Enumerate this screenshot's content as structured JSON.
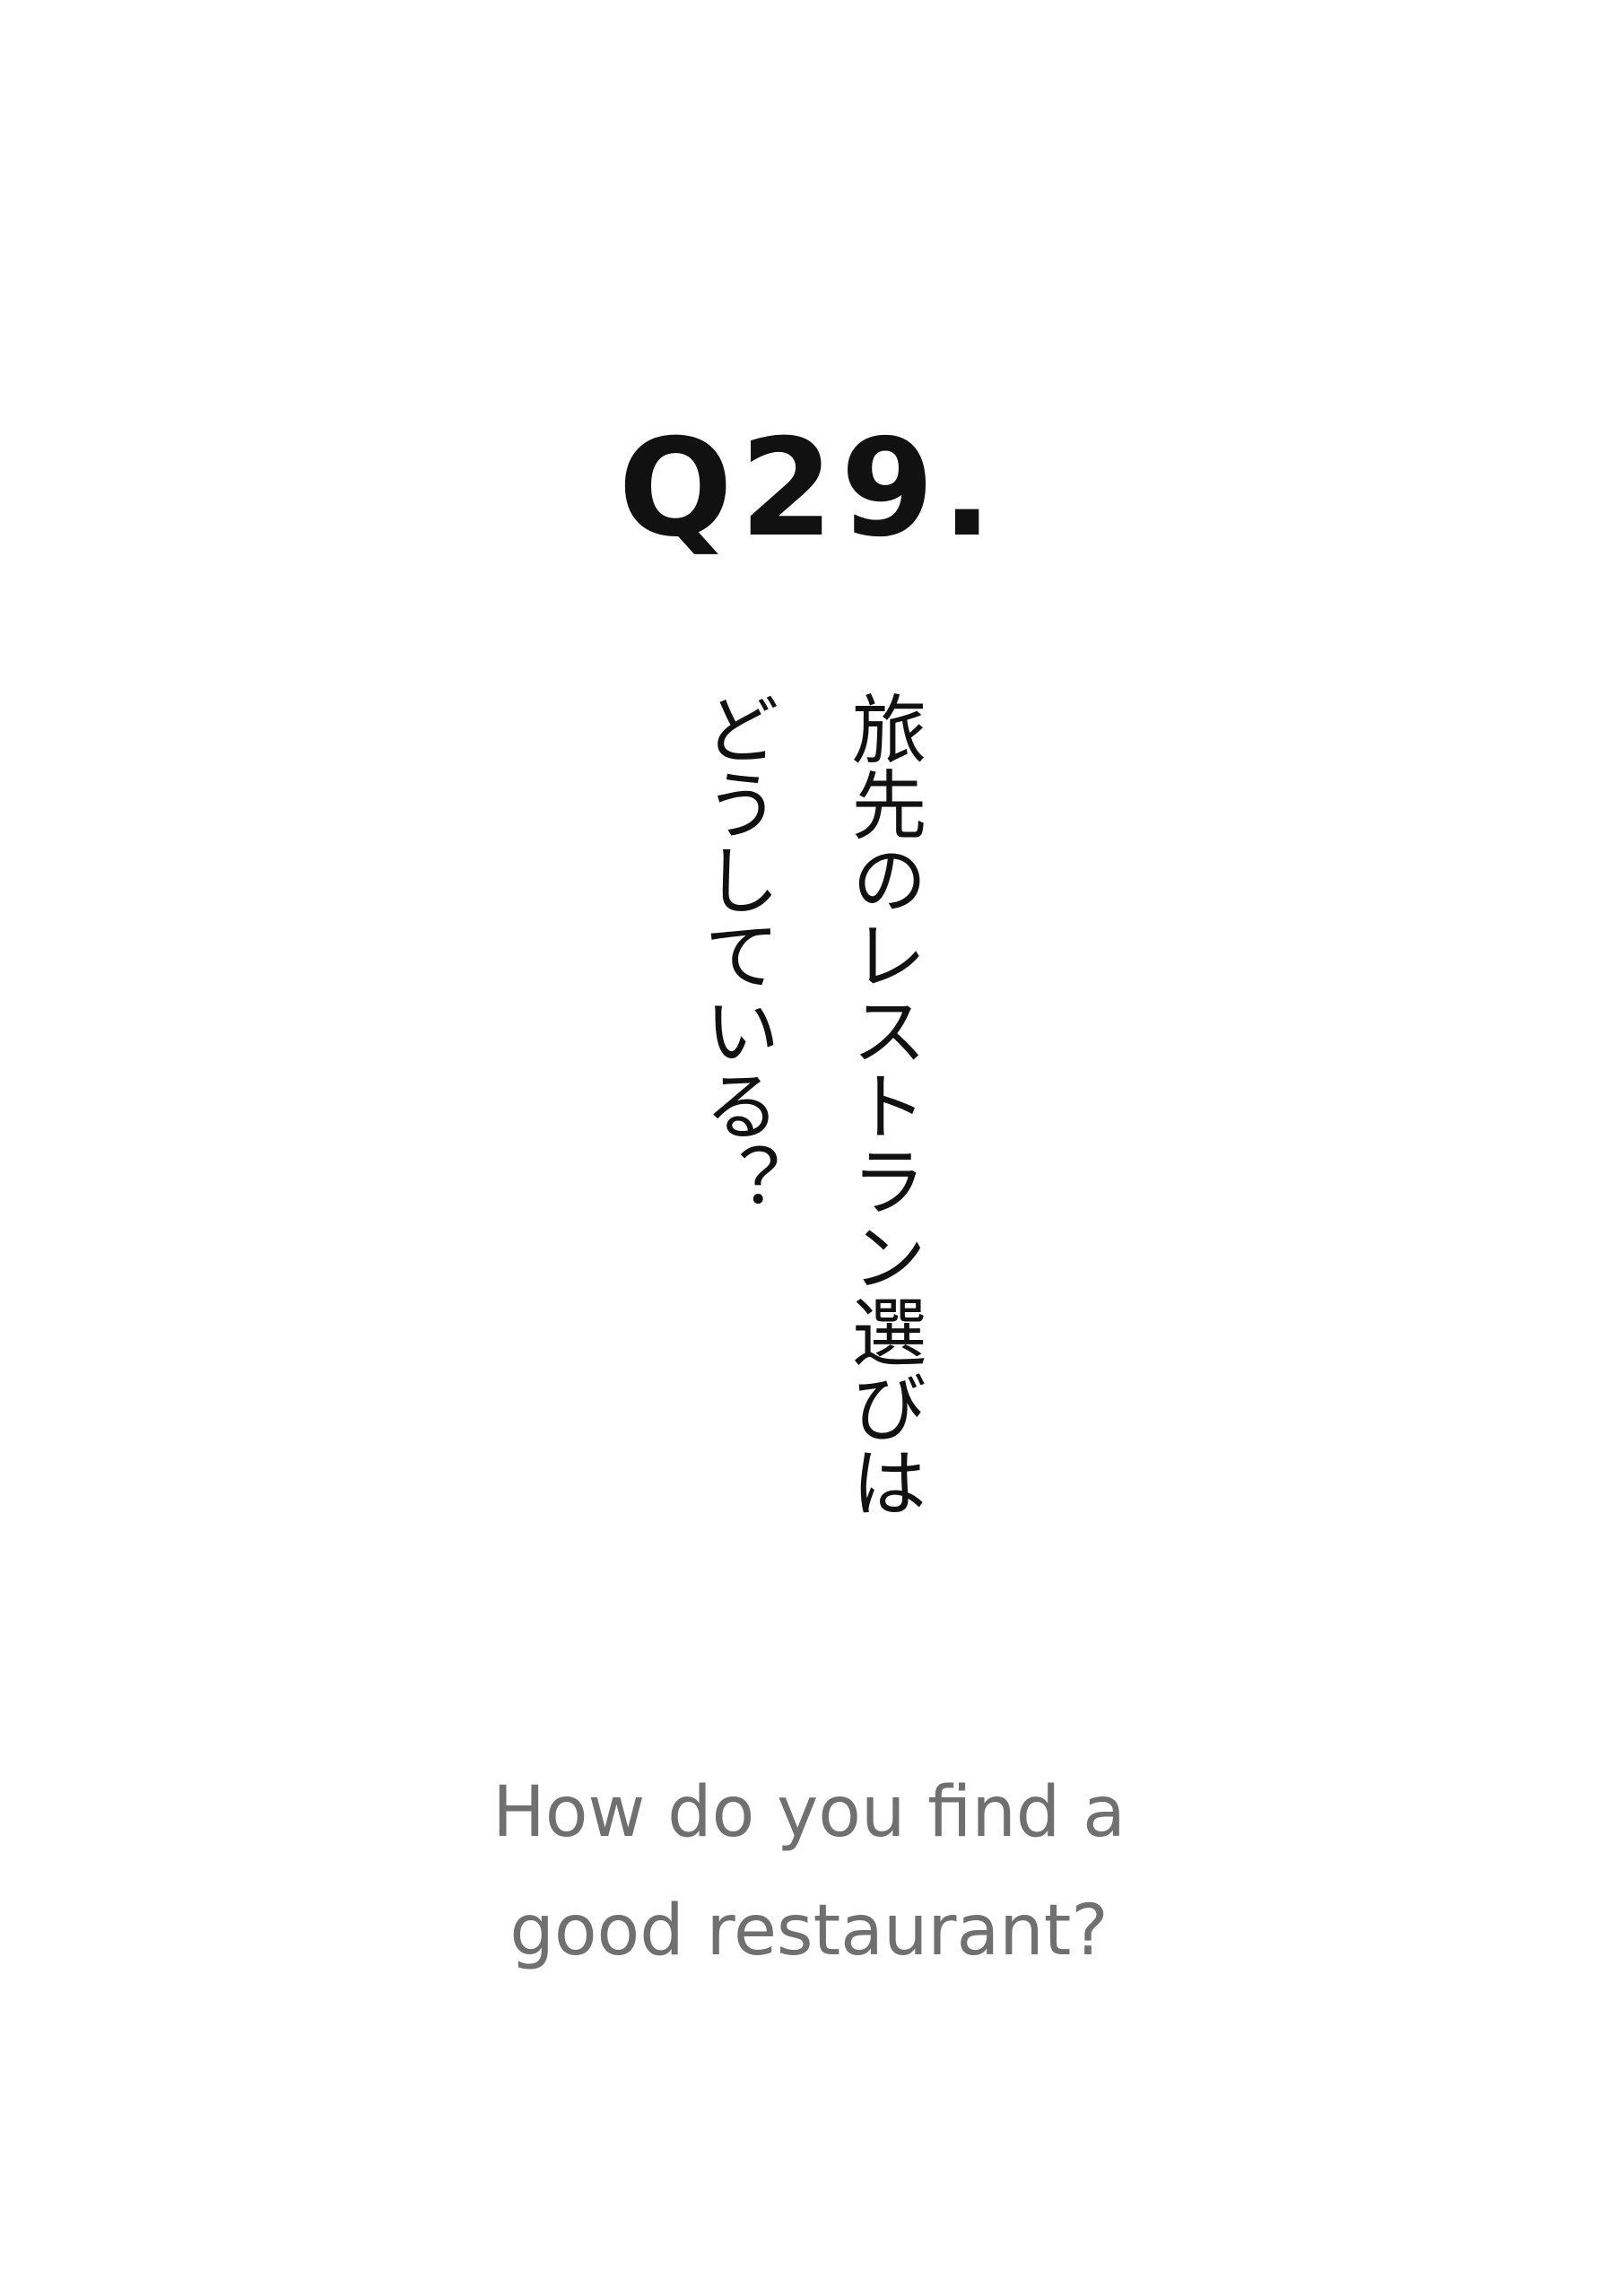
{
  "question": {
    "number": "Q29.",
    "japanese_lines": [
      "旅先のレストラン選びは",
      "どうしている？"
    ],
    "english_lines": [
      "How do you find a",
      "good restaurant?"
    ]
  }
}
